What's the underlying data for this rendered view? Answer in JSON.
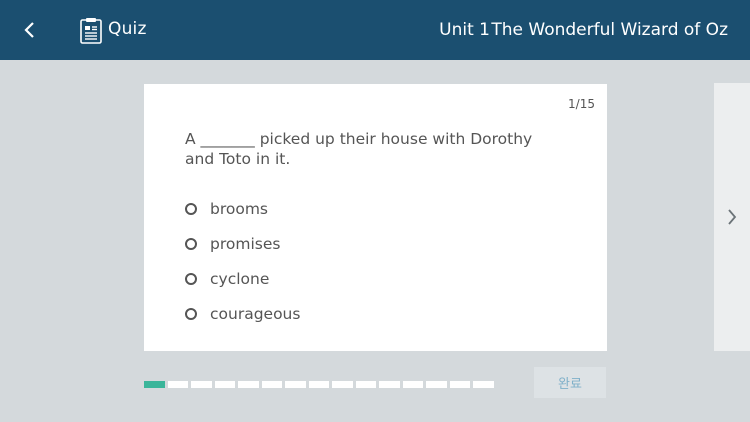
{
  "header": {
    "section_label": "Quiz",
    "unit_label": "Unit 1",
    "book_title": "The Wonderful Wizard of Oz"
  },
  "question": {
    "counter": "1/15",
    "text": "A _______ picked up their house with Dorothy and Toto in it.",
    "options": [
      "brooms",
      "promises",
      "cyclone",
      "courageous"
    ]
  },
  "progress": {
    "current": 1,
    "total": 15
  },
  "footer": {
    "done_label": "완료"
  },
  "colors": {
    "header_bg": "#1b4f70",
    "progress_active": "#3ab59a",
    "page_bg": "#d4d9dc"
  }
}
